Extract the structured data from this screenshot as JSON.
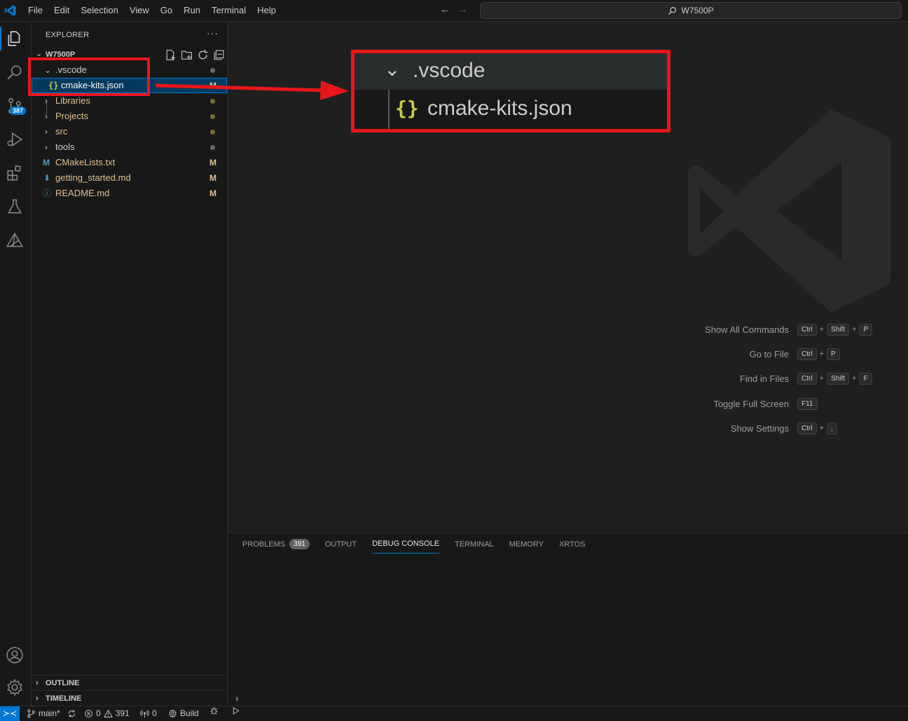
{
  "titlebar": {
    "menu": [
      "File",
      "Edit",
      "Selection",
      "View",
      "Go",
      "Run",
      "Terminal",
      "Help"
    ],
    "search_text": "W7500P"
  },
  "activity": {
    "scm_badge": "387"
  },
  "sidebar": {
    "title": "EXPLORER",
    "more": "···",
    "workspace": "W7500P",
    "tree": [
      {
        "label": ".vscode",
        "type": "folder",
        "expanded": true,
        "decoration": "dot"
      },
      {
        "label": "cmake-kits.json",
        "type": "json",
        "icon": "{}",
        "decoration": "M"
      },
      {
        "label": "Libraries",
        "type": "folder",
        "expanded": false,
        "decoration": "dot"
      },
      {
        "label": "Projects",
        "type": "folder",
        "expanded": false,
        "decoration": "dot"
      },
      {
        "label": "src",
        "type": "folder",
        "expanded": false,
        "decoration": "dot"
      },
      {
        "label": "tools",
        "type": "folder",
        "expanded": false,
        "decoration": "dot"
      },
      {
        "label": "CMakeLists.txt",
        "type": "cmake",
        "icon": "M",
        "decoration": "M"
      },
      {
        "label": "getting_started.md",
        "type": "markdown",
        "icon": "⬇",
        "decoration": "M"
      },
      {
        "label": "README.md",
        "type": "info",
        "icon": "ⓘ",
        "decoration": "M"
      }
    ],
    "outline": "OUTLINE",
    "timeline": "TIMELINE"
  },
  "callout": {
    "folder": ".vscode",
    "file": "cmake-kits.json",
    "file_icon": "{}"
  },
  "shortcuts": [
    {
      "label": "Show All Commands",
      "keys": [
        "Ctrl",
        "Shift",
        "P"
      ]
    },
    {
      "label": "Go to File",
      "keys": [
        "Ctrl",
        "P"
      ]
    },
    {
      "label": "Find in Files",
      "keys": [
        "Ctrl",
        "Shift",
        "F"
      ]
    },
    {
      "label": "Toggle Full Screen",
      "keys": [
        "F11"
      ]
    },
    {
      "label": "Show Settings",
      "keys": [
        "Ctrl",
        ","
      ]
    }
  ],
  "panel": {
    "tabs": [
      "PROBLEMS",
      "OUTPUT",
      "DEBUG CONSOLE",
      "TERMINAL",
      "MEMORY",
      "XRTOS"
    ],
    "problems_count": "391",
    "active_tab": "DEBUG CONSOLE",
    "prompt": "›"
  },
  "statusbar": {
    "branch": "main*",
    "errors": "0",
    "warnings": "391",
    "ports": "0",
    "build": "Build"
  },
  "colors": {
    "accent": "#0078d4",
    "highlight_red": "#e8161b",
    "modified": "#e2c08d",
    "json_icon": "#cbcb41"
  }
}
